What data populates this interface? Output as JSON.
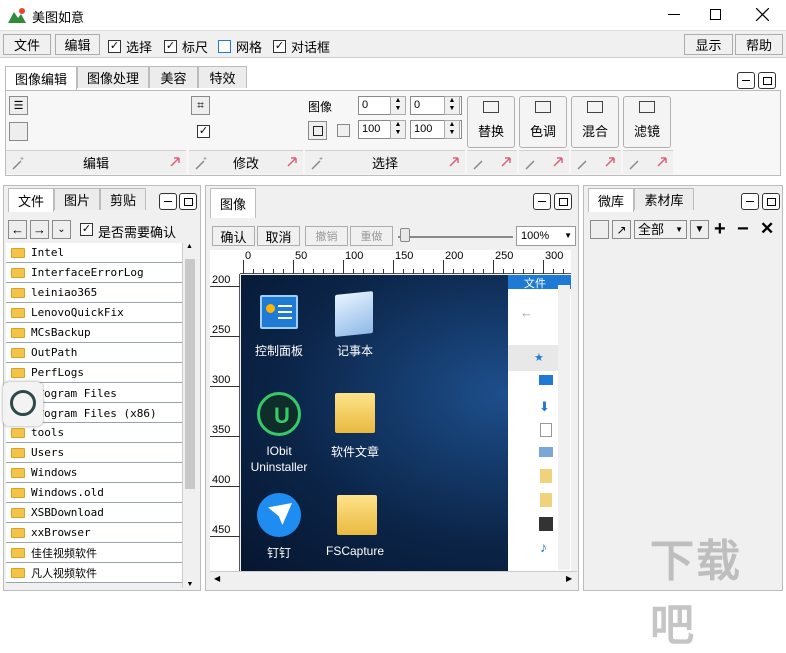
{
  "window": {
    "title": "美图如意"
  },
  "toolbar": {
    "file": "文件",
    "edit": "编辑",
    "chk_select": "选择",
    "chk_ruler": "标尺",
    "chk_grid": "网格",
    "chk_dialog": "对话框",
    "show": "显示",
    "help": "帮助"
  },
  "ribbon": {
    "tabs": [
      "图像编辑",
      "图像处理",
      "美容",
      "特效"
    ],
    "group_edit": "编辑",
    "group_modify": "修改",
    "group_select": "选择",
    "image_label": "图像",
    "spin_x": "0",
    "spin_y": "0",
    "spin_w": "100",
    "spin_h": "100",
    "btn_replace": "替换",
    "btn_tone": "色调",
    "btn_mix": "混合",
    "btn_filter": "滤镜"
  },
  "left_panel": {
    "tabs": [
      "文件",
      "图片",
      "剪贴"
    ],
    "confirm_label": "是否需要确认",
    "files": [
      "Intel",
      "InterfaceErrorLog",
      "leiniao365",
      "LenovoQuickFix",
      "MCsBackup",
      "OutPath",
      "PerfLogs",
      "Program Files",
      "Program Files (x86)",
      "tools",
      "Users",
      "Windows",
      "Windows.old",
      "XSBDownload",
      "xxBrowser",
      "佳佳视频软件",
      "凡人视频软件"
    ],
    "overlay_files": [
      "ogram Files",
      "ogram Files (x86)"
    ]
  },
  "center_panel": {
    "tab": "图像",
    "confirm": "确认",
    "cancel": "取消",
    "undo": "撤销",
    "redo": "重做",
    "zoom": "100%",
    "ruler_x": [
      "0",
      "50",
      "100",
      "150",
      "200",
      "250",
      "300"
    ],
    "ruler_y": [
      "200",
      "250",
      "300",
      "350",
      "400",
      "450"
    ],
    "desktop_icons": [
      "控制面板",
      "记事本",
      "IObit\nUninstaller",
      "软件文章",
      "钉钉",
      "FSCapture"
    ],
    "explorer_label": "文件"
  },
  "right_panel": {
    "tabs": [
      "微库",
      "素材库"
    ],
    "filter": "全部"
  },
  "watermark": "下载吧",
  "colors": {
    "desktop": "#0b2447",
    "folder": "#f3c34a",
    "accent": "#1e7bd1"
  }
}
